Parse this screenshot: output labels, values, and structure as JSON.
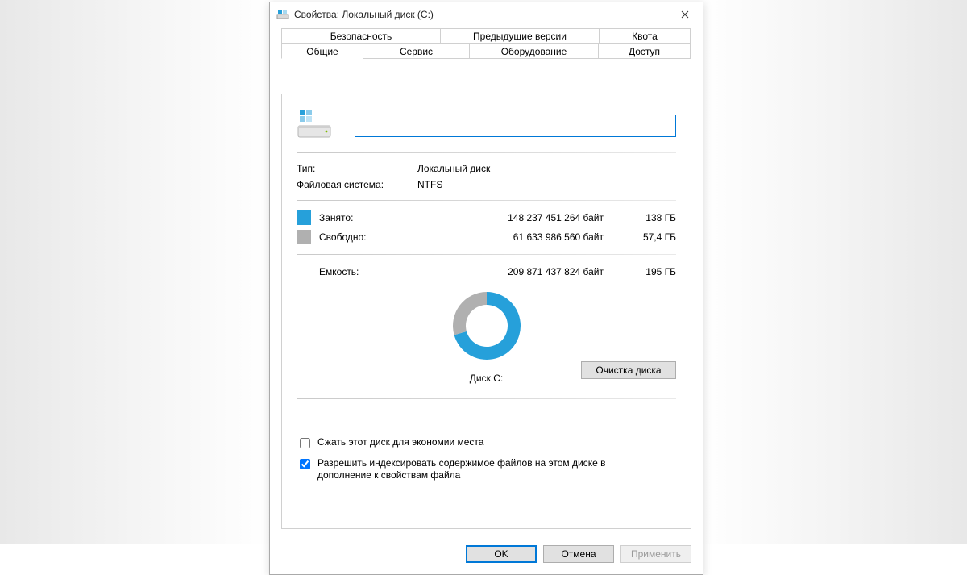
{
  "window": {
    "title": "Свойства: Локальный диск (C:)"
  },
  "tabs": {
    "security": "Безопасность",
    "previous": "Предыдущие версии",
    "quota": "Квота",
    "general": "Общие",
    "service": "Сервис",
    "hardware": "Оборудование",
    "access": "Доступ"
  },
  "general": {
    "name_value": "",
    "type_label": "Тип:",
    "type_value": "Локальный диск",
    "fs_label": "Файловая система:",
    "fs_value": "NTFS",
    "used_label": "Занято:",
    "used_bytes": "148 237 451 264 байт",
    "used_gb": "138 ГБ",
    "free_label": "Свободно:",
    "free_bytes": "61 633 986 560 байт",
    "free_gb": "57,4 ГБ",
    "cap_label": "Емкость:",
    "cap_bytes": "209 871 437 824 байт",
    "cap_gb": "195 ГБ",
    "disk_label": "Диск C:",
    "cleanup": "Очистка диска",
    "compress": "Сжать этот диск для экономии места",
    "index": "Разрешить индексировать содержимое файлов на этом диске в дополнение к свойствам файла"
  },
  "buttons": {
    "ok": "OK",
    "cancel": "Отмена",
    "apply": "Применить"
  },
  "colors": {
    "used": "#26a0da",
    "free": "#b0b0b0"
  },
  "chart_data": {
    "type": "pie",
    "title": "Диск C:",
    "categories": [
      "Занято",
      "Свободно"
    ],
    "values": [
      148237451264,
      61633986560
    ],
    "series": [
      {
        "name": "bytes",
        "values": [
          148237451264,
          61633986560
        ]
      }
    ],
    "percent_used": 70.6
  }
}
